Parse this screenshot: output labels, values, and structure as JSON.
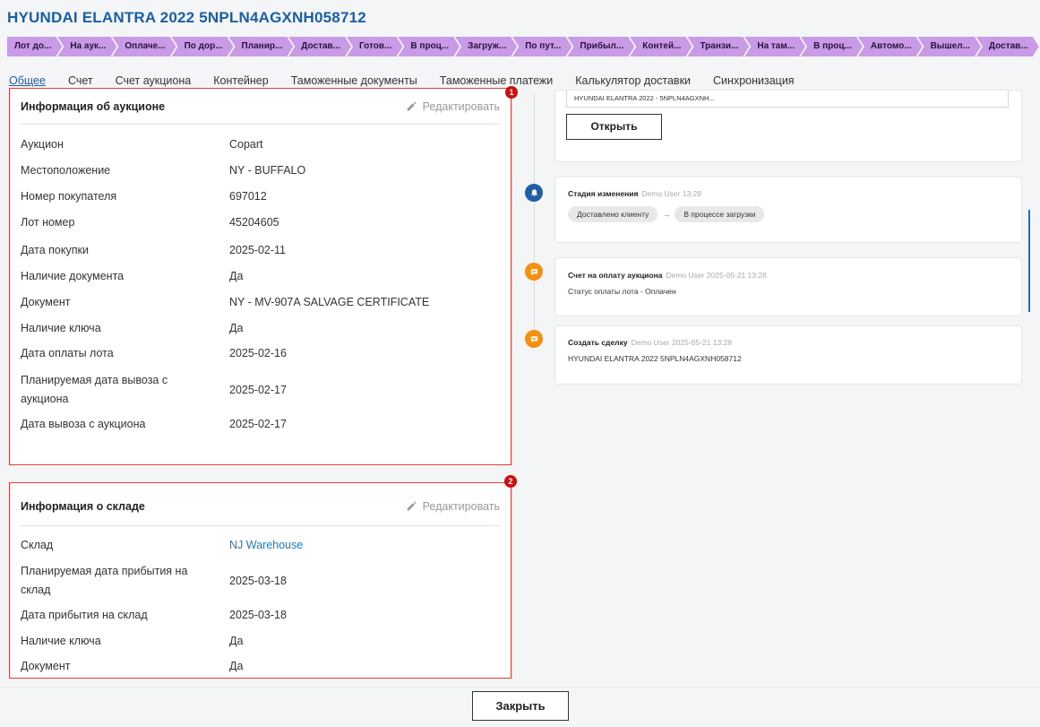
{
  "header": {
    "title": "HYUNDAI ELANTRA 2022 5NPLN4AGXNH058712"
  },
  "stages": [
    "Лот до...",
    "На аук...",
    "Оплаче...",
    "По дор...",
    "Планир...",
    "Достав...",
    "Готов...",
    "В проц...",
    "Загруж...",
    "По пут...",
    "Прибыл...",
    "Контей...",
    "Транзи...",
    "На там...",
    "В проц...",
    "Автомо...",
    "Вышел...",
    "Достав..."
  ],
  "tabs": [
    "Общее",
    "Счет",
    "Счет аукциона",
    "Контейнер",
    "Таможенные документы",
    "Таможенные платежи",
    "Калькулятор доставки",
    "Синхронизация"
  ],
  "auction_card": {
    "badge": "1",
    "title": "Информация об аукционе",
    "edit_label": "Редактировать",
    "rows": [
      {
        "label": "Аукцион",
        "value": "Copart"
      },
      {
        "label": "Местоположение",
        "value": "NY - BUFFALO"
      },
      {
        "label": "Номер покупателя",
        "value": "697012"
      },
      {
        "label": "Лот номер",
        "value": "45204605"
      },
      {
        "label": "Дата покупки",
        "value": "2025-02-11"
      },
      {
        "label": "Наличие документа",
        "value": "Да"
      },
      {
        "label": "Документ",
        "value": "NY - MV-907A SALVAGE CERTIFICATE"
      },
      {
        "label": "Наличие ключа",
        "value": "Да"
      },
      {
        "label": "Дата оплаты лота",
        "value": "2025-02-16"
      },
      {
        "label": "Планируемая дата вывоза с аукциона",
        "value": "2025-02-17"
      },
      {
        "label": "Дата вывоза с аукциона",
        "value": "2025-02-17"
      }
    ]
  },
  "warehouse_card": {
    "badge": "2",
    "title": "Информация о складе",
    "edit_label": "Редактировать",
    "rows": [
      {
        "label": "Склад",
        "value": "NJ Warehouse"
      },
      {
        "label": "Планируемая дата прибытия на склад",
        "value": "2025-03-18"
      },
      {
        "label": "Дата прибытия на склад",
        "value": "2025-03-18"
      },
      {
        "label": "Наличие ключа",
        "value": "Да"
      },
      {
        "label": "Документ",
        "value": "Да"
      }
    ]
  },
  "timeline": {
    "top_card": {
      "input_value": "HYUNDAI ELANTRA 2022 - 5NPLN4AGXNH...",
      "open_label": "Открыть"
    },
    "events": [
      {
        "icon": "bell-icon",
        "title": "Стадия изменения",
        "meta": "Demo User 13:28",
        "from": "Доставлено клиенту",
        "to": "В процессе загрузки"
      },
      {
        "icon": "comment-icon",
        "title": "Счет на оплату аукциона",
        "meta": "Demo User 2025-05-21 13:28",
        "body": "Статус оплаты лота - Оплачен"
      },
      {
        "icon": "comment-icon",
        "title": "Создать сделку",
        "meta": "Demo User 2025-05-21 13:28",
        "body": "HYUNDAI ELANTRA 2022 5NPLN4AGXNH058712"
      }
    ]
  },
  "footer": {
    "close_label": "Закрыть"
  },
  "colors": {
    "accent": "#1a5ea8",
    "stage": "#c99be6",
    "highlight_border": "#e03c3c",
    "timeline_blue": "#1f5fa8",
    "timeline_orange": "#f29111"
  }
}
